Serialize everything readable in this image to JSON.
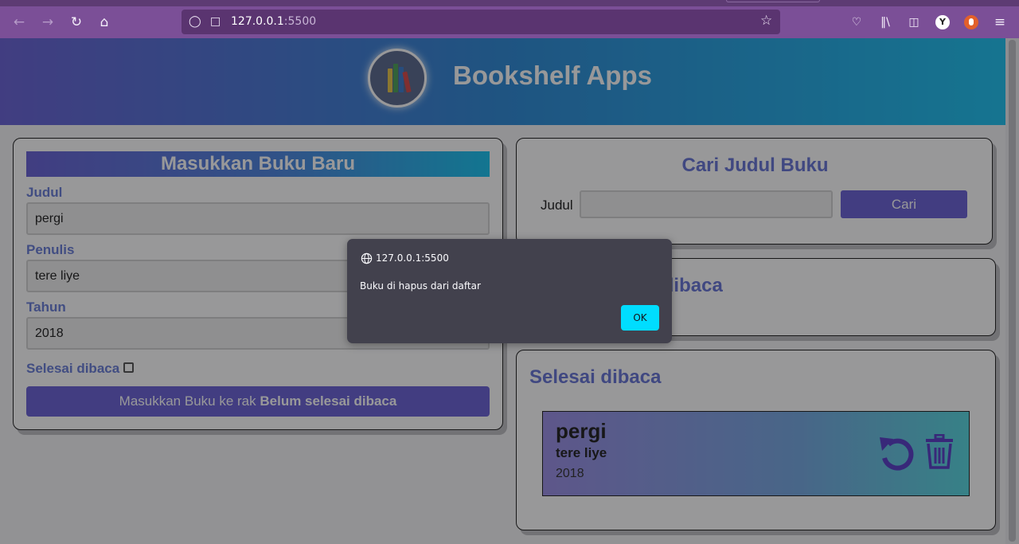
{
  "browser": {
    "url_host": "127.0.0.1",
    "url_port": ":5500",
    "icons": [
      "back-icon",
      "forward-icon",
      "reload-icon",
      "home-icon",
      "shield-icon",
      "page-icon",
      "star-icon",
      "pocket-icon",
      "library-icon",
      "sidebar-icon",
      "account-icon",
      "extension-icon",
      "menu-icon"
    ],
    "avatar_y": "Y"
  },
  "header": {
    "title": "Bookshelf Apps"
  },
  "form": {
    "title": "Masukkan Buku Baru",
    "judul_label": "Judul",
    "judul_value": "pergi",
    "penulis_label": "Penulis",
    "penulis_value": "tere liye",
    "tahun_label": "Tahun",
    "tahun_value": "2018",
    "selesai_label": "Selesai dibaca",
    "submit_prefix": "Masukkan Buku ke rak ",
    "submit_bold": "Belum selesai dibaca"
  },
  "search": {
    "title": "Cari Judul Buku",
    "label": "Judul",
    "value": "",
    "button": "Cari"
  },
  "incomplete": {
    "title": "Belum selesai dibaca"
  },
  "complete": {
    "title": "Selesai dibaca",
    "books": [
      {
        "title": "pergi",
        "author": "tere liye",
        "year": "2018"
      }
    ]
  },
  "dialog": {
    "host": "127.0.0.1:5500",
    "message": "Buku di hapus dari daftar",
    "ok": "OK"
  },
  "colors": {
    "accent": "#6b63d6",
    "heading": "#6875d6",
    "dialog_button": "#00ddff",
    "browser_toolbar": "#7b4f97"
  }
}
